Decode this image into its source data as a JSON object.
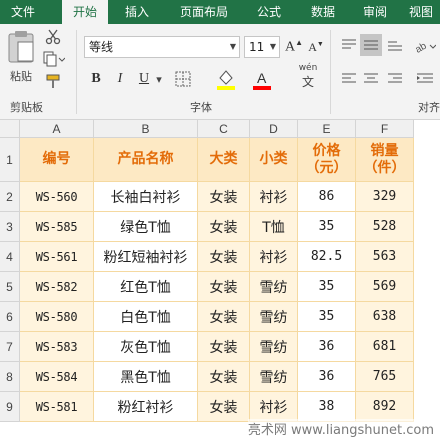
{
  "tabs": [
    "文件",
    "开始",
    "插入",
    "页面布局",
    "公式",
    "数据",
    "审阅",
    "视图"
  ],
  "active_tab": "开始",
  "ribbon": {
    "paste_label": "粘贴",
    "clipboard_label": "剪贴板",
    "font_name": "等线",
    "font_size": "11",
    "font_group_label": "字体",
    "bold": "B",
    "italic": "I",
    "underline": "U",
    "phonetic_label": "wén",
    "align_label": "对齐"
  },
  "colors": {
    "tab_bar": "#217346",
    "header_fill": "#fde9c4",
    "header_text": "#e36c09",
    "row_fill": "#fff4de",
    "fill_color_swatch": "#ffff00",
    "font_color_swatch": "#ff0000"
  },
  "sheet": {
    "columns": [
      "A",
      "B",
      "C",
      "D",
      "E",
      "F"
    ],
    "rows": [
      "1",
      "2",
      "3",
      "4",
      "5",
      "6",
      "7",
      "8",
      "9"
    ],
    "header": [
      "编号",
      "产品名称",
      "大类",
      "小类",
      "价格\n（元）",
      "销量\n（件）"
    ],
    "data": [
      [
        "WS-560",
        "长袖白衬衫",
        "女装",
        "衬衫",
        "86",
        "329"
      ],
      [
        "WS-585",
        "绿色T恤",
        "女装",
        "T恤",
        "35",
        "528"
      ],
      [
        "WS-561",
        "粉红短袖衬衫",
        "女装",
        "衬衫",
        "82.5",
        "563"
      ],
      [
        "WS-582",
        "红色T恤",
        "女装",
        "雪纺",
        "35",
        "569"
      ],
      [
        "WS-580",
        "白色T恤",
        "女装",
        "雪纺",
        "35",
        "638"
      ],
      [
        "WS-583",
        "灰色T恤",
        "女装",
        "雪纺",
        "36",
        "681"
      ],
      [
        "WS-584",
        "黑色T恤",
        "女装",
        "雪纺",
        "36",
        "765"
      ],
      [
        "WS-581",
        "粉红衬衫",
        "女装",
        "衬衫",
        "38",
        "892"
      ]
    ]
  },
  "watermark": "亮术网 www.liangshunet.com"
}
